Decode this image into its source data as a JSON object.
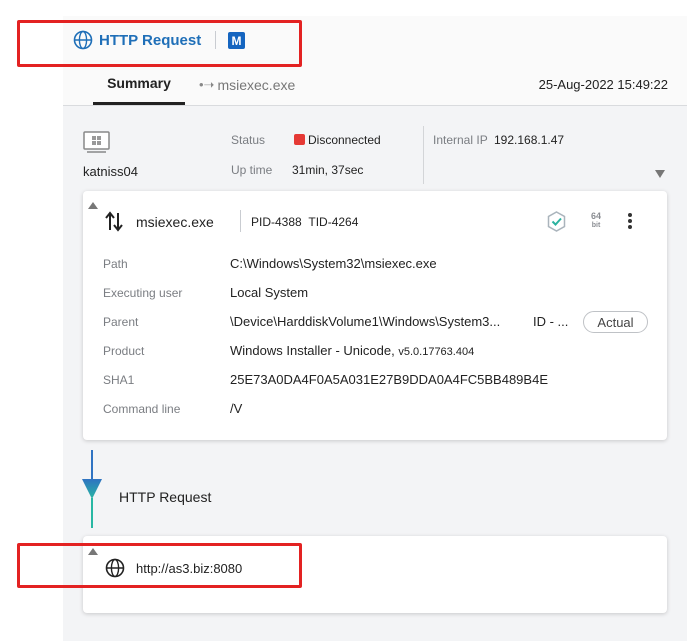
{
  "header": {
    "title": "HTTP Request",
    "logo_letter": "M"
  },
  "tabs": [
    {
      "label": "Summary",
      "active": true
    },
    {
      "label": "msiexec.exe",
      "active": false
    }
  ],
  "timestamp": "25-Aug-2022 15:49:22",
  "host": {
    "name": "katniss04",
    "status_label": "Status",
    "status_value": "Disconnected",
    "uptime_label": "Up time",
    "uptime_value": "31min, 37sec",
    "ip_label": "Internal IP",
    "ip_value": "192.168.1.47"
  },
  "process": {
    "name": "msiexec.exe",
    "pid": "PID-4388",
    "tid": "TID-4264",
    "bits_number": "64",
    "bits_unit": "bit",
    "details": {
      "path_label": "Path",
      "path_value": "C:\\Windows\\System32\\msiexec.exe",
      "user_label": "Executing user",
      "user_value": "Local System",
      "parent_label": "Parent",
      "parent_value": "\\Device\\HarddiskVolume1\\Windows\\System3...",
      "parent_id": "ID - ...",
      "actual_label": "Actual",
      "product_label": "Product",
      "product_value": "Windows Installer - Unicode,",
      "product_version": "v5.0.17763.404",
      "sha1_label": "SHA1",
      "sha1_value": "25E73A0DA4F0A5A031E27B9DDA0A4FC5BB489B4E",
      "cmd_label": "Command line",
      "cmd_value": "/V"
    }
  },
  "flow": {
    "label": "HTTP Request"
  },
  "request": {
    "url": "http://as3.biz:8080"
  },
  "colors": {
    "accent": "#1f6fb8",
    "status_disconnected": "#e53935",
    "highlight_box": "#e32222",
    "flow_top": "#2f73c2",
    "flow_bottom": "#28b7a3"
  },
  "icons": [
    "globe-icon",
    "vendor-logo-icon",
    "computer-icon",
    "process-arrows-icon",
    "verified-badge-icon",
    "kebab-menu-icon",
    "expand-icon",
    "collapse-icon",
    "flow-arrow-icon"
  ]
}
